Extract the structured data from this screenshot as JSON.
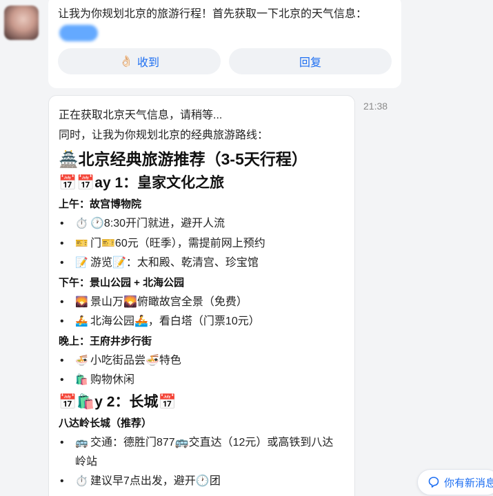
{
  "top_message": {
    "text": "让我为你规划北京的旅游行程！首先获取一下北京的天气信息：",
    "btn_received_icon": "👌🏻",
    "btn_received": "收到",
    "btn_reply": "回复"
  },
  "timestamp": "21:38",
  "reply": {
    "line1": "正在获取北京天气信息，请稍等...",
    "line2": "同时，让我为你规划北京的经典旅游路线：",
    "title": "🏯北京经典旅游推荐（3-5天行程）",
    "day1": {
      "heading": "📅📅ay 1：皇家文化之旅",
      "morning": "上午：故宫博物院",
      "morning_items": [
        {
          "icon": "⏱️",
          "text": "🕐8:30开门就进，避开人流"
        },
        {
          "icon": "🎫",
          "text": "门🎫60元（旺季），需提前网上预约"
        },
        {
          "icon": "📝",
          "text": "游览📝：太和殿、乾清宫、珍宝馆"
        }
      ],
      "afternoon": "下午：景山公园 + 北海公园",
      "afternoon_items": [
        {
          "icon": "🌄",
          "text": "景山万🌄俯瞰故宫全景（免费）"
        },
        {
          "icon": "🚣",
          "text": "北海公园🚣，看白塔（门票10元）"
        }
      ],
      "evening": "晚上：王府井步行街",
      "evening_items": [
        {
          "icon": "🍜",
          "text": "小吃街品尝🍜特色"
        },
        {
          "icon": "🛍️",
          "text": "购物休闲"
        }
      ]
    },
    "day2": {
      "heading": "📅🛍️y 2：长城📅",
      "sub": "八达岭长城（推荐）",
      "items": [
        {
          "icon": "🚌",
          "text": "交通：德胜门877🚌交直达（12元）或高铁到八达岭站"
        },
        {
          "icon": "⏱️",
          "text": "建议早7点出发，避开🕐团"
        }
      ]
    }
  },
  "new_message": "你有新消息"
}
